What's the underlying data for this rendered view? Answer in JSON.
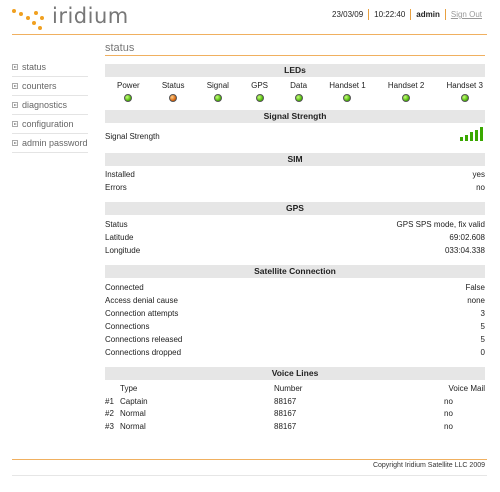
{
  "brand": {
    "name": "iridium"
  },
  "topbar": {
    "date": "23/03/09",
    "time": "10:22:40",
    "user": "admin",
    "sign_out": "Sign Out"
  },
  "sidebar": {
    "items": [
      {
        "label": "status"
      },
      {
        "label": "counters"
      },
      {
        "label": "diagnostics"
      },
      {
        "label": "configuration"
      },
      {
        "label": "admin password"
      }
    ]
  },
  "page": {
    "title": "status"
  },
  "leds": {
    "header": "LEDs",
    "items": [
      {
        "label": "Power",
        "state": "green"
      },
      {
        "label": "Status",
        "state": "orange"
      },
      {
        "label": "Signal",
        "state": "green"
      },
      {
        "label": "GPS",
        "state": "green"
      },
      {
        "label": "Data",
        "state": "green"
      },
      {
        "label": "Handset 1",
        "state": "green"
      },
      {
        "label": "Handset 2",
        "state": "green"
      },
      {
        "label": "Handset 3",
        "state": "green"
      }
    ]
  },
  "signal": {
    "header": "Signal Strength",
    "label": "Signal Strength",
    "bars": 5,
    "max_bars": 5
  },
  "sim": {
    "header": "SIM",
    "rows": [
      {
        "label": "Installed",
        "value": "yes"
      },
      {
        "label": "Errors",
        "value": "no"
      }
    ]
  },
  "gps": {
    "header": "GPS",
    "rows": [
      {
        "label": "Status",
        "value": "GPS SPS mode, fix valid"
      },
      {
        "label": "Latitude",
        "value": "69:02.608"
      },
      {
        "label": "Longitude",
        "value": "033:04.338"
      }
    ]
  },
  "satellite": {
    "header": "Satellite Connection",
    "rows": [
      {
        "label": "Connected",
        "value": "False"
      },
      {
        "label": "Access denial cause",
        "value": "none"
      },
      {
        "label": "Connection attempts",
        "value": "3"
      },
      {
        "label": "Connections",
        "value": "5"
      },
      {
        "label": "Connections released",
        "value": "5"
      },
      {
        "label": "Connections dropped",
        "value": "0"
      }
    ]
  },
  "voice": {
    "header": "Voice Lines",
    "columns": {
      "num": "",
      "type": "Type",
      "number": "Number",
      "voicemail": "Voice Mail"
    },
    "rows": [
      {
        "num": "#1",
        "type": "Captain",
        "number": "88167",
        "voicemail": "no"
      },
      {
        "num": "#2",
        "type": "Normal",
        "number": "88167",
        "voicemail": "no"
      },
      {
        "num": "#3",
        "type": "Normal",
        "number": "88167",
        "voicemail": "no"
      }
    ]
  },
  "footer": {
    "copyright": "Copyright Iridium Satellite LLC 2009"
  },
  "colors": {
    "accent": "#f0a020",
    "led_green": "#45b400",
    "led_orange": "#d45a00",
    "signal": "#3aa800",
    "section_bg": "#e6e6e6"
  }
}
